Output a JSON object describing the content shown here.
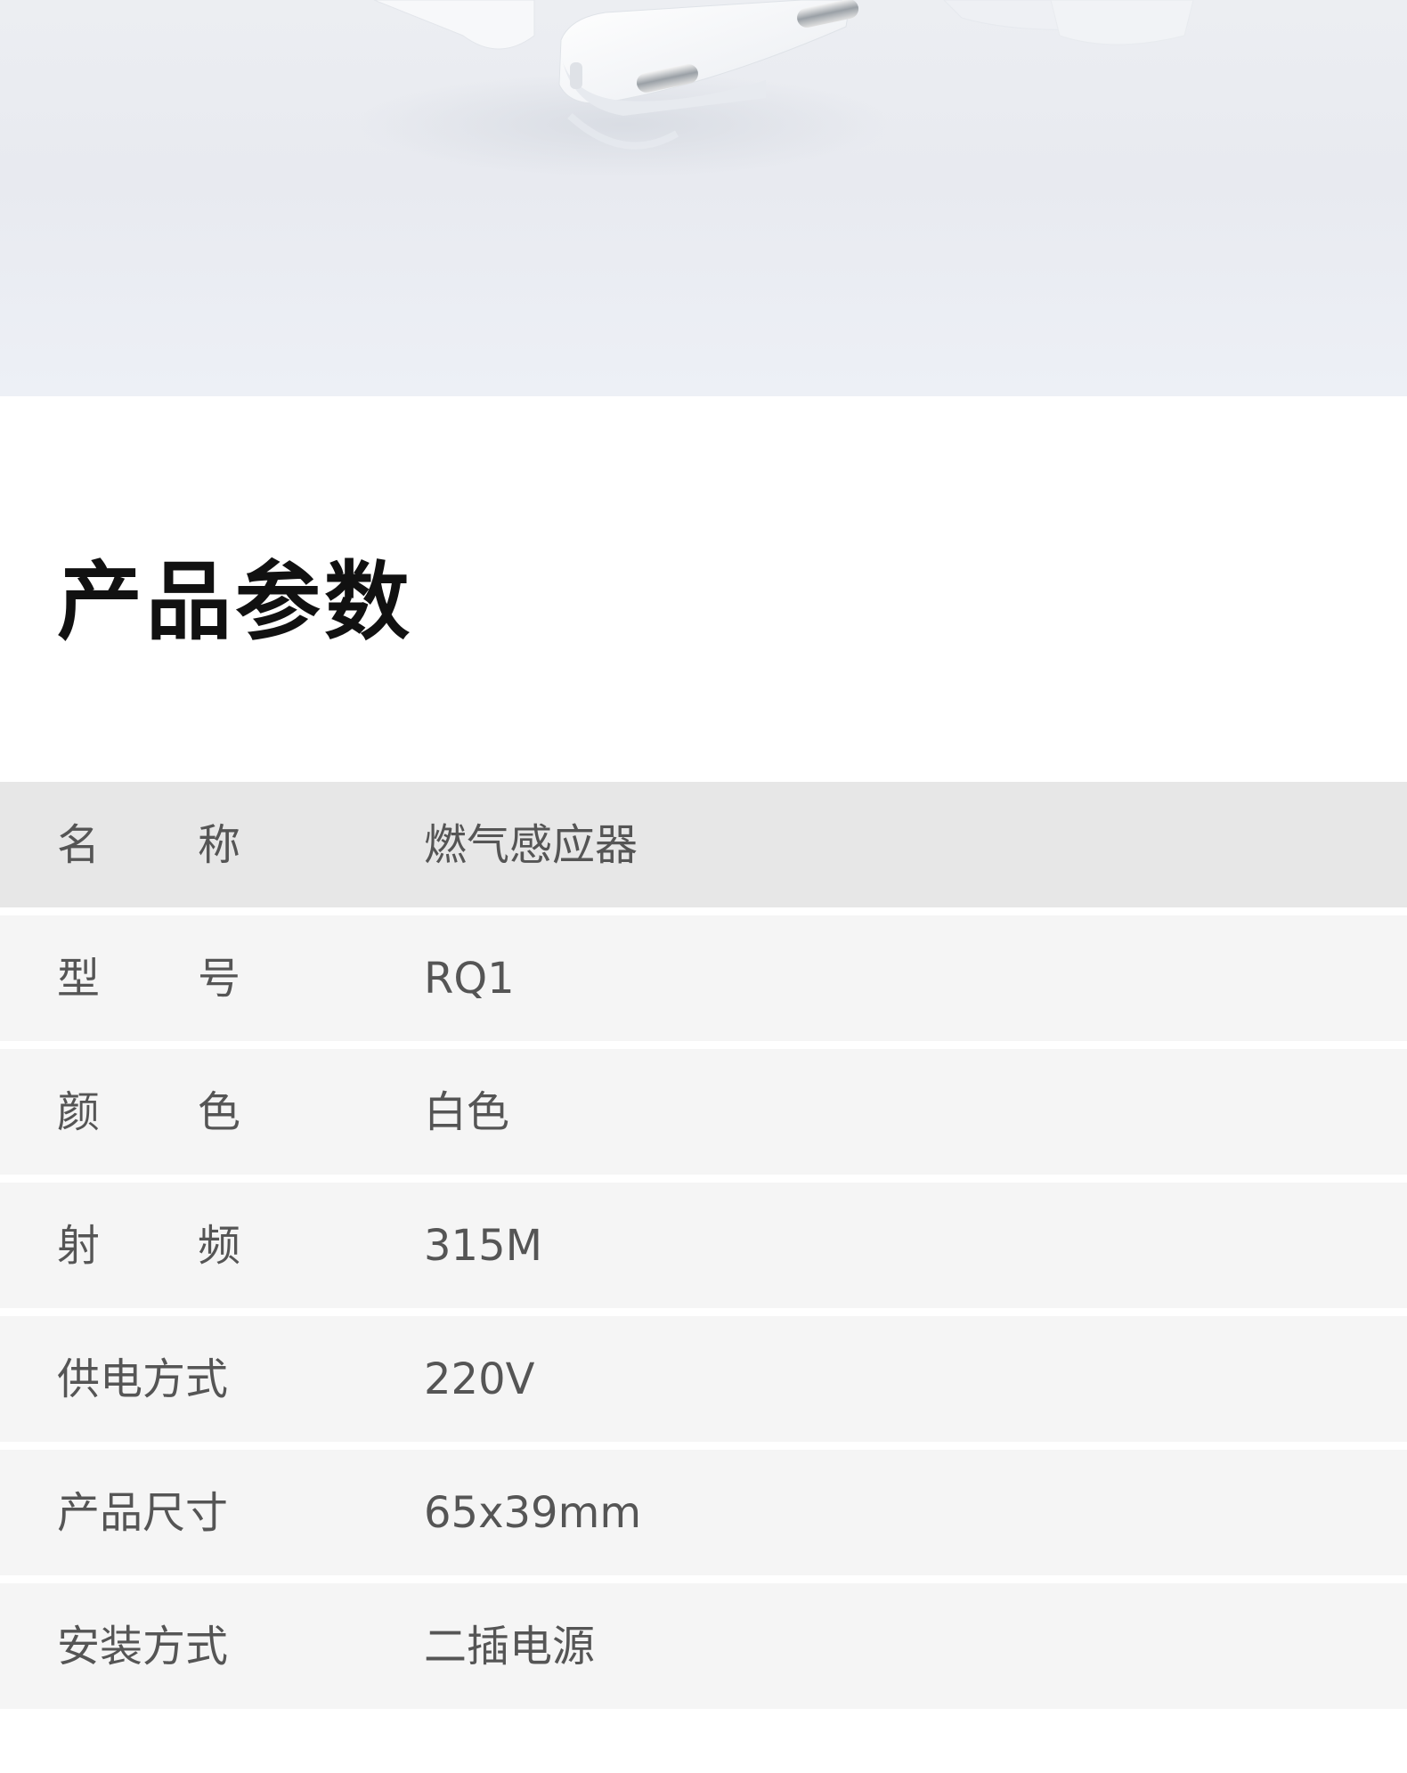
{
  "hero": {
    "image_description": "white gas sensor with two-pin plug on light gradient background"
  },
  "section": {
    "title": "产品参数"
  },
  "specs": [
    {
      "label_a": "名",
      "label_b": "称",
      "value": "燃气感应器"
    },
    {
      "label_a": "型",
      "label_b": "号",
      "value": "RQ1"
    },
    {
      "label_a": "颜",
      "label_b": "色",
      "value": "白色"
    },
    {
      "label_a": "射",
      "label_b": "频",
      "value": "315M"
    },
    {
      "label": "供电方式",
      "value": "220V"
    },
    {
      "label": "产品尺寸",
      "value": "65x39mm"
    },
    {
      "label": "安装方式",
      "value": "二插电源"
    }
  ]
}
